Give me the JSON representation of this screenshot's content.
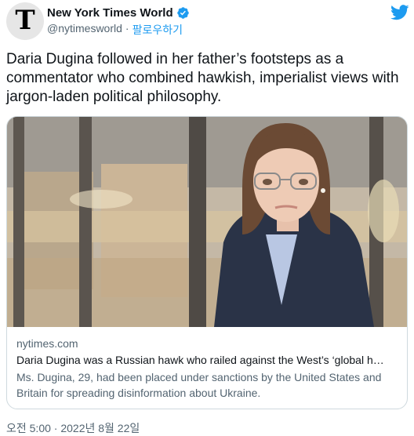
{
  "author": {
    "display_name": "New York Times World",
    "handle": "@nytimesworld",
    "separator": "·",
    "follow_label": "팔로우하기",
    "avatar_glyph": "T",
    "avatar_icon": "nyt-logo-icon",
    "verified_icon": "verified-badge-icon"
  },
  "brand": {
    "icon": "twitter-bird-icon",
    "color": "#1d9bf0"
  },
  "tweet": {
    "text": "Daria Dugina followed in her father’s footsteps as a commentator who combined hawkish, imperialist views with jargon-laden political philosophy.",
    "timestamp": "오전 5:00 · 2022년 8월 22일"
  },
  "card": {
    "domain": "nytimes.com",
    "title": "Daria Dugina was a Russian hawk who railed against the West’s ‘global h…",
    "description": "Ms. Dugina, 29, had been placed under sanctions by the United States and Britain for spreading disinformation about Ukraine.",
    "image_subject": "portrait-photo"
  },
  "colors": {
    "text": "#0f1419",
    "muted": "#536471",
    "link": "#1d9bf0",
    "border": "#cfd9de"
  }
}
